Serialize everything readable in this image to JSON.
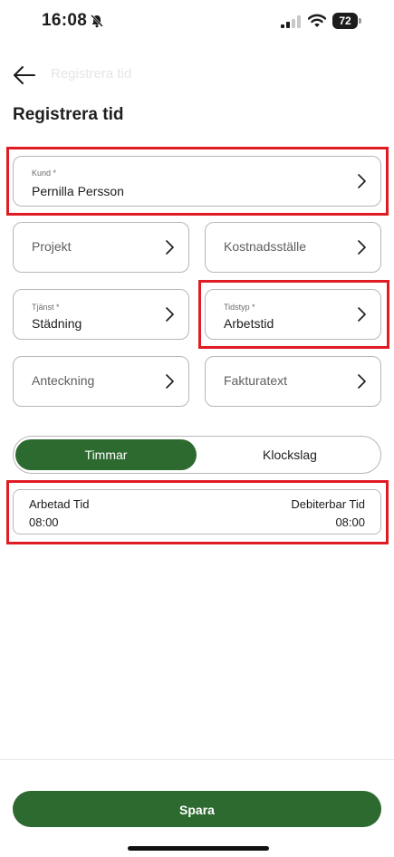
{
  "status_bar": {
    "time": "16:08",
    "battery": "72"
  },
  "header": {
    "nav_title": "Registrera tid",
    "title": "Registrera tid"
  },
  "fields": {
    "kund": {
      "label": "Kund *",
      "value": "Pernilla Persson"
    },
    "projekt": {
      "placeholder": "Projekt"
    },
    "kostnadsstalle": {
      "placeholder": "Kostnadsställe"
    },
    "tjanst": {
      "label": "Tjänst *",
      "value": "Städning"
    },
    "tidstyp": {
      "label": "Tidstyp *",
      "value": "Arbetstid"
    },
    "anteckning": {
      "placeholder": "Anteckning"
    },
    "fakturatext": {
      "placeholder": "Fakturatext"
    }
  },
  "mode_toggle": {
    "active": "Timmar",
    "inactive": "Klockslag"
  },
  "time_summary": {
    "worked_label": "Arbetad Tid",
    "worked_value": "08:00",
    "billable_label": "Debiterbar Tid",
    "billable_value": "08:00"
  },
  "save_label": "Spara",
  "colors": {
    "primary": "#2d6a30",
    "highlight": "#e01b24",
    "border": "#b7b7b7"
  },
  "icons": [
    "bell-slash-icon",
    "signal-icon",
    "wifi-icon",
    "battery-icon",
    "back-arrow-icon",
    "chevron-right-icon"
  ]
}
